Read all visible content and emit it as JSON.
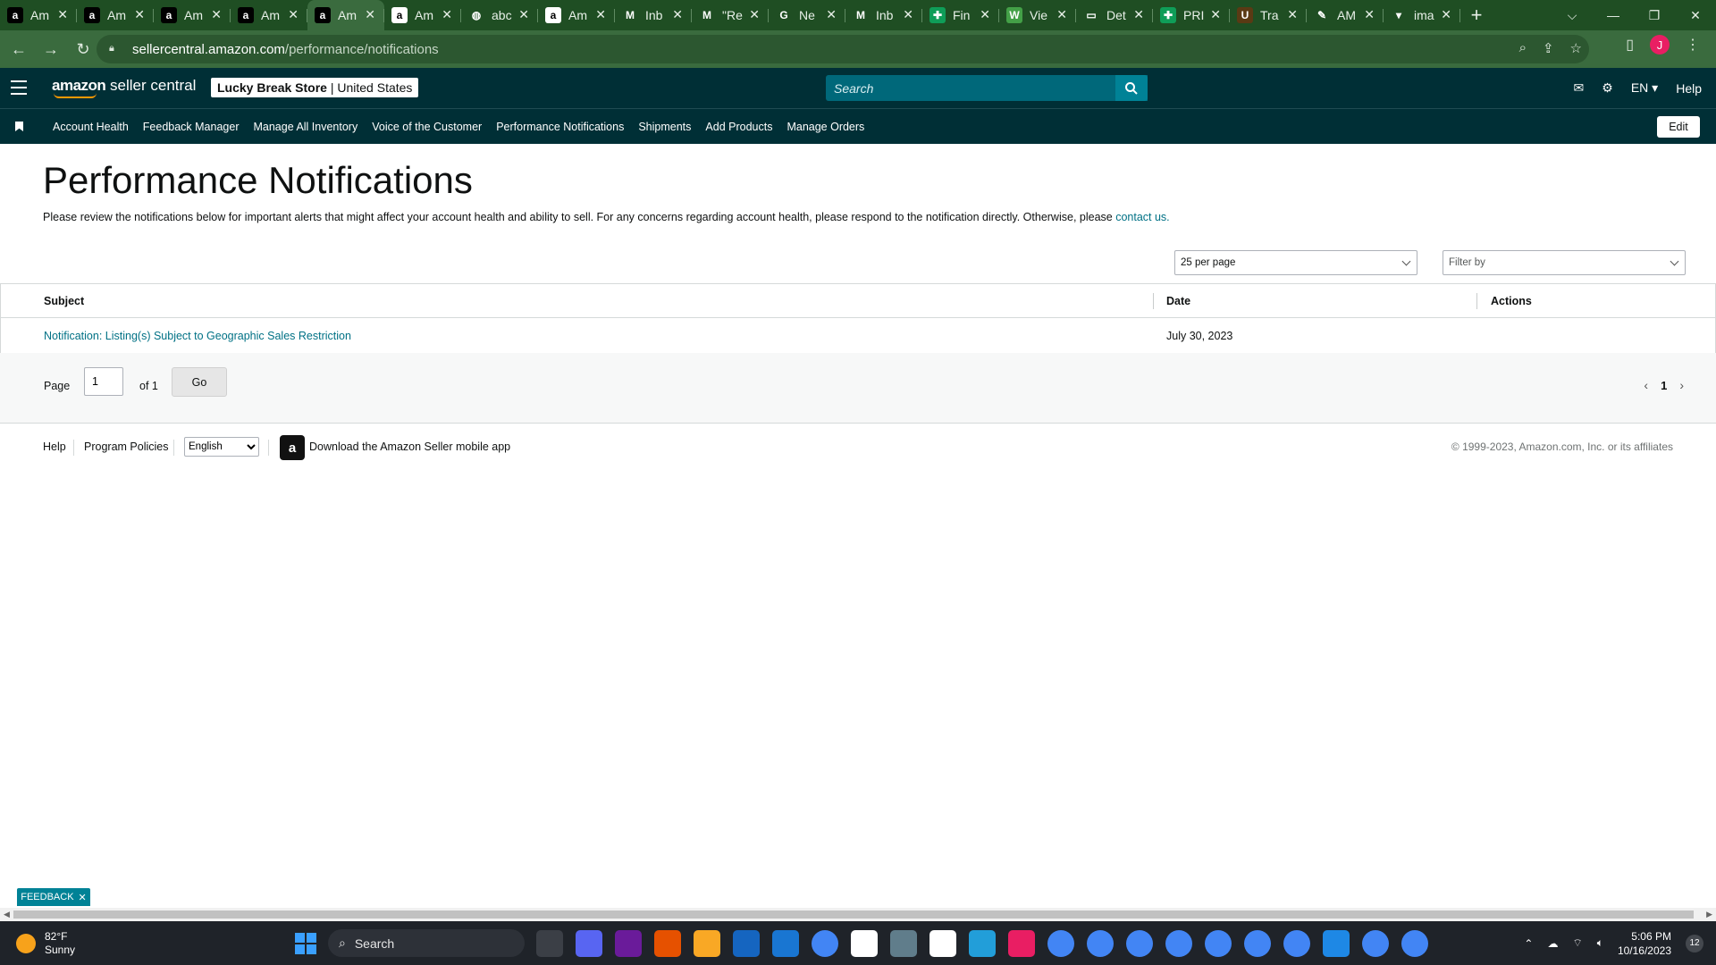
{
  "browser": {
    "tabs": [
      {
        "label": "Am",
        "icon": "amazon-icon",
        "color": "#000000",
        "glyph": "a"
      },
      {
        "label": "Am",
        "icon": "amazon-icon",
        "color": "#000000",
        "glyph": "a"
      },
      {
        "label": "Am",
        "icon": "amazon-icon",
        "color": "#000000",
        "glyph": "a"
      },
      {
        "label": "Am",
        "icon": "amazon-icon",
        "color": "#000000",
        "glyph": "a"
      },
      {
        "label": "Am",
        "icon": "amazon-icon",
        "color": "#000000",
        "glyph": "a",
        "active": true
      },
      {
        "label": "Am",
        "icon": "amazon-icon",
        "color": "#ffffff",
        "glyph": "a"
      },
      {
        "label": "abc",
        "icon": "globe-icon",
        "color": "#1f4e23",
        "glyph": "◍"
      },
      {
        "label": "Am",
        "icon": "amazon-icon",
        "color": "#ffffff",
        "glyph": "a"
      },
      {
        "label": "Inb",
        "icon": "gmail-icon",
        "color": "#1f4e23",
        "glyph": "M"
      },
      {
        "label": "\"Re",
        "icon": "gmail-icon",
        "color": "#1f4e23",
        "glyph": "M"
      },
      {
        "label": "Ne",
        "icon": "google-icon",
        "color": "#1f4e23",
        "glyph": "G"
      },
      {
        "label": "Inb",
        "icon": "gmail-icon",
        "color": "#1f4e23",
        "glyph": "M"
      },
      {
        "label": "Fin",
        "icon": "sheets-icon",
        "color": "#0f9d58",
        "glyph": "✚"
      },
      {
        "label": "Vie",
        "icon": "w-app-icon",
        "color": "#43a047",
        "glyph": "W"
      },
      {
        "label": "Det",
        "icon": "flag-icon",
        "color": "#1f4e23",
        "glyph": "▭"
      },
      {
        "label": "PRI",
        "icon": "sheets-icon",
        "color": "#0f9d58",
        "glyph": "✚"
      },
      {
        "label": "Tra",
        "icon": "ups-icon",
        "color": "#5a3a14",
        "glyph": "U"
      },
      {
        "label": "AM",
        "icon": "pen-icon",
        "color": "#1f4e23",
        "glyph": "✎"
      },
      {
        "label": "ima",
        "icon": "image-icon",
        "color": "#1f4e23",
        "glyph": "▾"
      }
    ],
    "url_host": "sellercentral.amazon.com",
    "url_path": "/performance/notifications",
    "profile_initial": "J"
  },
  "header": {
    "logo_brand": "amazon",
    "logo_product": "seller central",
    "store_name": "Lucky Break Store",
    "marketplace": "United States",
    "search_placeholder": "Search",
    "language": "EN",
    "help": "Help"
  },
  "nav": {
    "items": [
      "Account Health",
      "Feedback Manager",
      "Manage All Inventory",
      "Voice of the Customer",
      "Performance Notifications",
      "Shipments",
      "Add Products",
      "Manage Orders"
    ],
    "edit": "Edit"
  },
  "main": {
    "title": "Performance Notifications",
    "intro": "Please review the notifications below for important alerts that might affect your account health and ability to sell. For any concerns regarding account health, please respond to the notification directly. Otherwise, please ",
    "intro_link": "contact us.",
    "per_page": "25 per page",
    "filter": "Filter by",
    "columns": {
      "subject": "Subject",
      "date": "Date",
      "actions": "Actions"
    },
    "rows": [
      {
        "subject": "Notification: Listing(s) Subject to Geographic Sales Restriction",
        "date": "July 30, 2023"
      }
    ],
    "pager": {
      "page_label": "Page",
      "page_value": "1",
      "of_label": "of 1",
      "go": "Go",
      "current": "1"
    }
  },
  "footer": {
    "help": "Help",
    "policies": "Program Policies",
    "language": "English",
    "app": "Download the Amazon Seller mobile app",
    "copyright": "© 1999-2023, Amazon.com, Inc. or its affiliates",
    "feedback": "FEEDBACK"
  },
  "taskbar": {
    "temp": "82°F",
    "weather": "Sunny",
    "search": "Search",
    "time": "5:06 PM",
    "date": "10/16/2023",
    "notifications": "12"
  },
  "colors": {
    "header": "#002f36",
    "link": "#007185",
    "search": "#00687a",
    "accent": "#008296"
  }
}
